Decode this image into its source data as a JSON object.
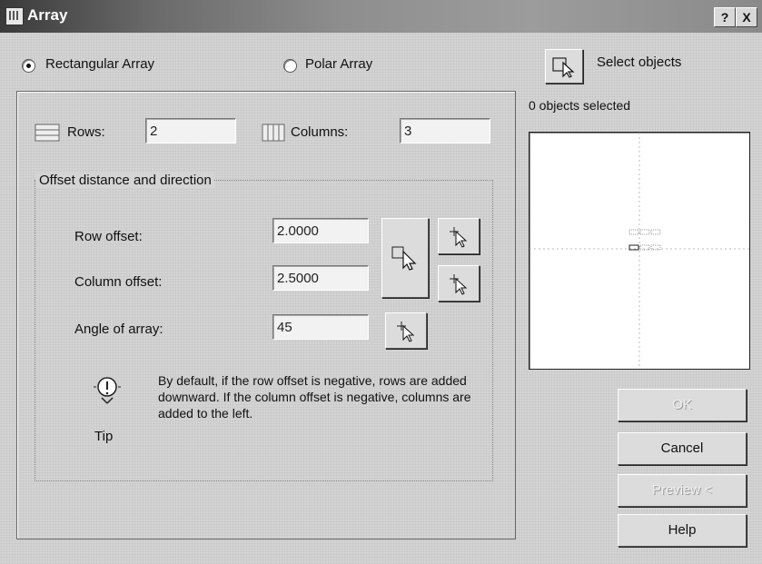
{
  "window": {
    "title": "Array",
    "help_button": "?",
    "close_button": "X"
  },
  "array_type": {
    "rectangular_label": "Rectangular Array",
    "polar_label": "Polar Array",
    "selected": "rectangular"
  },
  "rows": {
    "label": "Rows:",
    "value": "2"
  },
  "columns": {
    "label": "Columns:",
    "value": "3"
  },
  "offset_group": {
    "title": "Offset distance and direction",
    "row_offset": {
      "label": "Row offset:",
      "value": "2.0000"
    },
    "column_offset": {
      "label": "Column offset:",
      "value": "2.5000"
    },
    "angle": {
      "label": "Angle of array:",
      "value": "45"
    }
  },
  "tip": {
    "label": "Tip",
    "text": "By default, if the row offset is negative, rows are added downward.  If the column offset is negative, columns are added to the left."
  },
  "select_objects": {
    "label": "Select objects",
    "status": "0 objects selected"
  },
  "buttons": {
    "ok": "OK",
    "cancel": "Cancel",
    "preview": "Preview <",
    "help": "Help"
  }
}
